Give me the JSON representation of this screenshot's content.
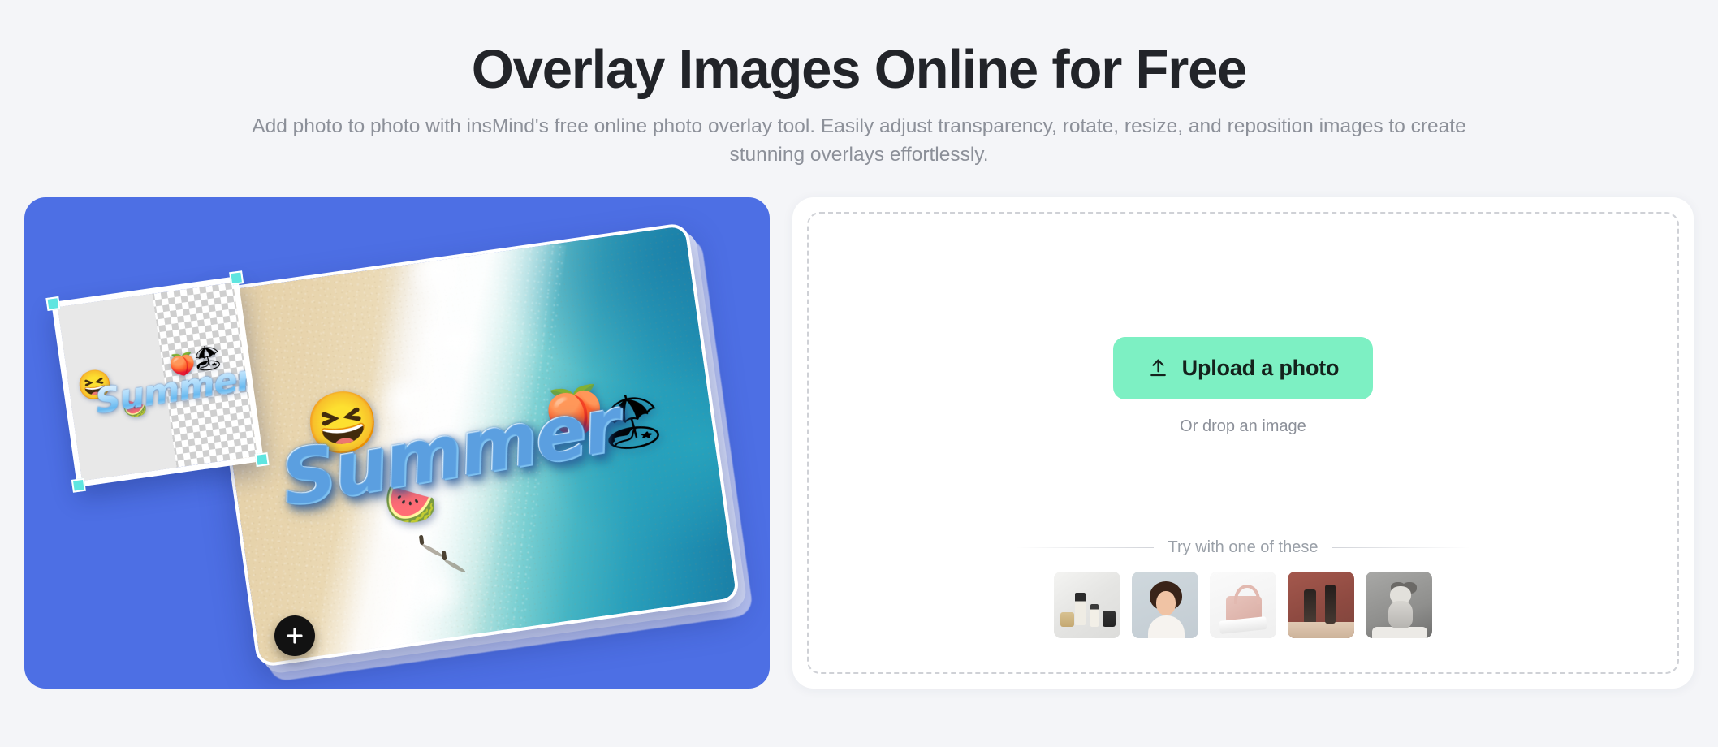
{
  "header": {
    "title": "Overlay Images Online for Free",
    "subtitle": "Add photo to photo with insMind's free online photo overlay tool. Easily adjust transparency, rotate, resize, and reposition images to create stunning overlays effortlessly."
  },
  "promo": {
    "panel_color": "#4d6fe4",
    "overlay_word": "Summer",
    "sticker_word": "Summer",
    "plus_badge_label": "+",
    "stickers": {
      "sun": "😆",
      "peach": "🍑",
      "beach_ball": "🏖",
      "watermelon": "🍉"
    }
  },
  "upload": {
    "button_label": "Upload a photo",
    "button_color": "#7df0c3",
    "icon": "upload-arrow-icon",
    "drop_hint": "Or drop an image"
  },
  "samples": {
    "label": "Try with one of these",
    "items": [
      {
        "name": "skincare-bottles",
        "alt": "Skincare serum bottles on white fabric"
      },
      {
        "name": "woman-portrait",
        "alt": "Smiling woman with curly hair"
      },
      {
        "name": "pink-handbag",
        "alt": "Pink leather handbag"
      },
      {
        "name": "cosmetic-tubes",
        "alt": "Cosmetic tubes on terracotta backdrop"
      },
      {
        "name": "kitten",
        "alt": "Gray and white kitten sitting"
      }
    ]
  },
  "colors": {
    "page_background": "#f4f5f8",
    "title": "#222429",
    "muted_text": "#8c9099",
    "dashed_border": "#cfd1d6",
    "handle": "#5ee5e0"
  }
}
